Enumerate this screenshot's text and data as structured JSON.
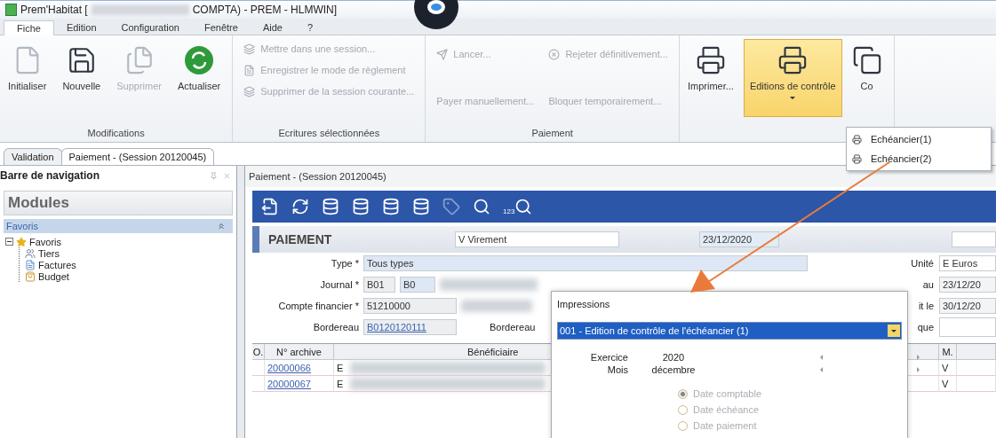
{
  "window": {
    "title_start": "Prem'Habitat [",
    "title_end": "COMPTA) - PREM - HLMWIN]"
  },
  "menu_tabs": [
    {
      "label": "Fiche",
      "selected": true
    },
    {
      "label": "Edition",
      "selected": false
    },
    {
      "label": "Configuration",
      "selected": false
    },
    {
      "label": "Fenêtre",
      "selected": false
    },
    {
      "label": "Aide",
      "selected": false
    },
    {
      "label": "?",
      "selected": false
    }
  ],
  "ribbon": {
    "groups": [
      {
        "kind": "large",
        "label": "Modifications",
        "items": [
          {
            "label": "Initialiser",
            "kind": "blank",
            "disabled": false,
            "highlighted": false,
            "has_menu": false
          },
          {
            "label": "Nouvelle",
            "kind": "new",
            "disabled": false,
            "highlighted": false,
            "has_menu": false
          },
          {
            "label": "Supprimer",
            "kind": "delete",
            "disabled": true,
            "highlighted": false,
            "has_menu": false
          },
          {
            "label": "Actualiser",
            "kind": "refresh",
            "disabled": false,
            "highlighted": false,
            "has_menu": false
          }
        ]
      },
      {
        "kind": "stack",
        "label": "Ecritures sélectionnées",
        "items": [
          {
            "label": "Mettre dans une session...",
            "kind": "stack",
            "disabled": true
          },
          {
            "label": "Enregistrer le mode de règlement",
            "kind": "page",
            "disabled": true
          },
          {
            "label": "Supprimer de la session courante...",
            "kind": "stack",
            "disabled": true
          }
        ]
      },
      {
        "kind": "pairs",
        "label": "Paiement",
        "items": [
          {
            "label": "Lancer...",
            "kind": "send",
            "disabled": true
          },
          {
            "label": "Payer manuellement...",
            "kind": "text",
            "disabled": true
          },
          {
            "label": "Rejeter définitivement...",
            "kind": "reject",
            "disabled": true
          },
          {
            "label": "Bloquer temporairement...",
            "kind": "text",
            "disabled": true
          }
        ]
      },
      {
        "kind": "large",
        "items": [
          {
            "label": "Imprimer...",
            "kind": "printer",
            "disabled": false,
            "highlighted": false,
            "has_menu": false
          },
          {
            "label": "Editions de contrôle",
            "kind": "printer",
            "disabled": false,
            "highlighted": true,
            "has_menu": true
          },
          {
            "label": "Co",
            "kind": "cut",
            "disabled": false,
            "highlighted": false,
            "has_menu": false
          }
        ]
      }
    ]
  },
  "dropdown": {
    "items": [
      {
        "label": "Echéancier(1)"
      },
      {
        "label": "Echéancier(2)"
      }
    ]
  },
  "doc_tabs": [
    {
      "label": "Validation",
      "selected": false
    },
    {
      "label": "Paiement - (Session 20120045)",
      "selected": true
    }
  ],
  "sidebar": {
    "title": "Barre de navigation",
    "modules": "Modules",
    "section": {
      "label": "Favoris",
      "expanded": true
    },
    "tree": [
      {
        "label": "Favoris",
        "kind": "star",
        "expanded": true,
        "children": [
          {
            "label": "Tiers",
            "kind": "people"
          },
          {
            "label": "Factures",
            "kind": "document"
          },
          {
            "label": "Budget",
            "kind": "bag"
          }
        ]
      }
    ]
  },
  "document": {
    "title": "Paiement - (Session 20120045)",
    "toolbar": [
      {
        "kind": "export",
        "disabled": false
      },
      {
        "kind": "refresh",
        "disabled": false
      },
      {
        "kind": "db-edit",
        "disabled": false
      },
      {
        "kind": "db-delete",
        "disabled": false
      },
      {
        "kind": "db-add",
        "disabled": false
      },
      {
        "kind": "db-remove",
        "disabled": false
      },
      {
        "kind": "tag",
        "disabled": true
      },
      {
        "kind": "search",
        "disabled": false
      },
      {
        "kind": "search-number",
        "disabled": false,
        "label": "123"
      }
    ],
    "header": {
      "title": "PAIEMENT",
      "mode": "V Virement",
      "date": "23/12/2020"
    },
    "type": {
      "label": "Type *",
      "value": "Tous types",
      "right_label": "Unité",
      "right_value": "E Euros"
    },
    "journal": {
      "label": "Journal *",
      "code": "B01",
      "value": "B0",
      "right_label": "au",
      "right_value": "23/12/20"
    },
    "account": {
      "label": "Compte financier *",
      "value": "51210000",
      "right_label": "it le",
      "right_value": "30/12/20"
    },
    "bordereau": {
      "label": "Bordereau",
      "value": "B0120120111",
      "second_label": "Bordereau",
      "right_label": "que"
    },
    "table": {
      "columns": [
        "O.",
        "N° archive",
        "Bénéficiaire",
        "M."
      ],
      "rows": [
        [
          "",
          "20000066",
          "E",
          "V"
        ],
        [
          "",
          "20000067",
          "E",
          "V"
        ]
      ]
    }
  },
  "dialog": {
    "title": "Impressions",
    "report": "001 - Edition de contrôle de l'échéancier (1)",
    "params": [
      {
        "label": "Exercice",
        "value": "2020"
      },
      {
        "label": "Mois",
        "value": "décembre"
      }
    ],
    "dates": [
      {
        "label": "Date comptable",
        "selected": true,
        "disabled": true
      },
      {
        "label": "Date échéance",
        "selected": false,
        "disabled": true
      },
      {
        "label": "Date paiement",
        "selected": false,
        "disabled": true
      }
    ]
  }
}
